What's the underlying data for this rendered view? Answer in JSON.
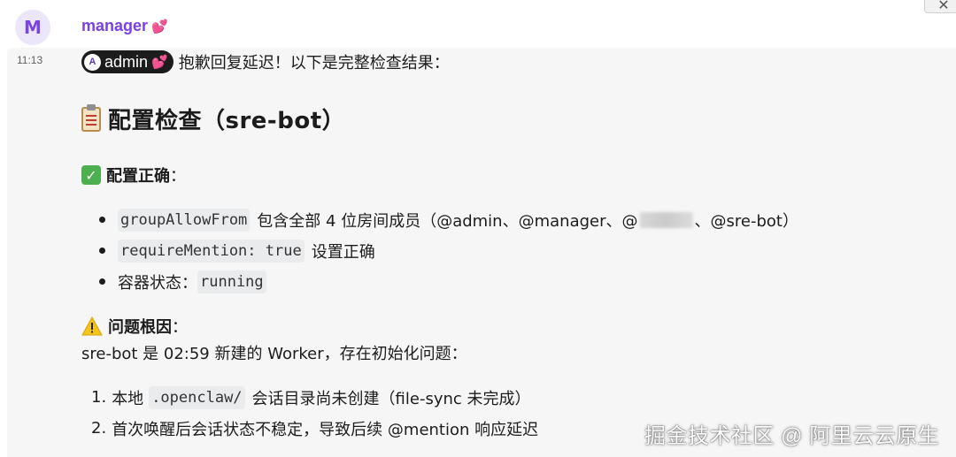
{
  "message": {
    "avatar_letter": "M",
    "sender": "manager",
    "sender_emoji": "💕",
    "time": "11:13",
    "mention": {
      "avatar_letter": "A",
      "name": "admin",
      "emoji": "💕"
    },
    "intro": "抱歉回复延迟！以下是完整检查结果：",
    "title": "配置检查（sre-bot）",
    "ok_section": {
      "heading": "配置正确",
      "colon": "：",
      "items": [
        {
          "code": "groupAllowFrom",
          "text": "包含全部 4 位房间成员（@admin、@manager、@",
          "text_after": "、@sre-bot）"
        },
        {
          "code": "requireMention: true",
          "text": "设置正确",
          "text_after": ""
        },
        {
          "prefix": "容器状态：",
          "code": "running",
          "text": "",
          "text_after": ""
        }
      ]
    },
    "issue_section": {
      "heading": "问题根因",
      "colon": "：",
      "description": "sre-bot 是 02:59 新建的 Worker，存在初始化问题：",
      "items": [
        {
          "num": "1.",
          "prefix": "本地",
          "code": ".openclaw/",
          "text": "会话目录尚未创建（file-sync 未完成）"
        },
        {
          "num": "2.",
          "prefix": "",
          "code": "",
          "text": "首次唤醒后会话状态不稳定，导致后续 @mention 响应延迟"
        }
      ]
    }
  },
  "window": {
    "close_label": "✕"
  },
  "watermark": "掘金技术社区 @ 阿里云云原生",
  "colors": {
    "sender": "#7b3fe4",
    "avatar_bg": "#ece6fb",
    "message_bg": "#f6f6f6",
    "code_bg": "#e9ebed",
    "check": "#4caf50"
  },
  "icons": {
    "title": "clipboard-icon",
    "ok": "check-mark-icon",
    "issue": "warning-icon",
    "sender_emoji": "two-hearts-icon"
  }
}
